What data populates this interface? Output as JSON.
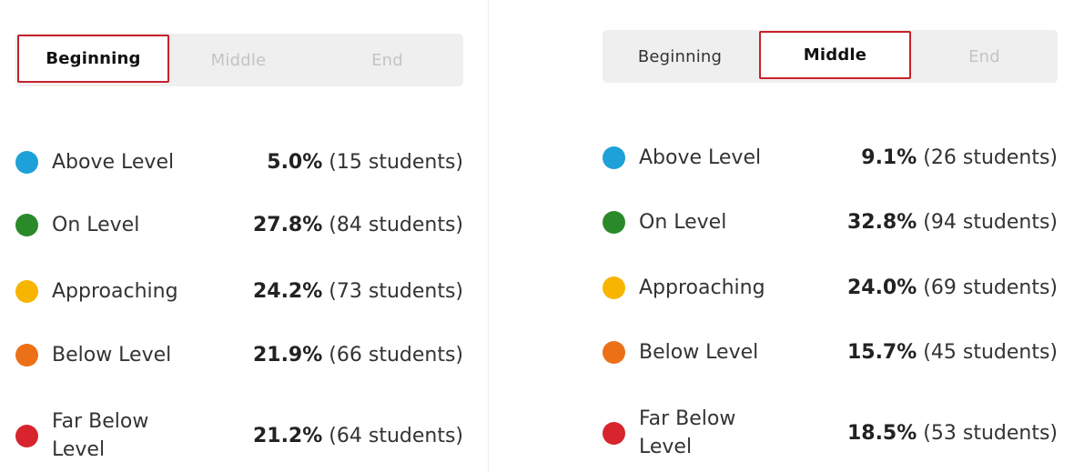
{
  "colors": {
    "above": "#1ea0d8",
    "on": "#2a8a2a",
    "approaching": "#f7b500",
    "below": "#ec7016",
    "far_below": "#d7242d",
    "active_border": "#c8202a"
  },
  "tabs": [
    "Beginning",
    "Middle",
    "End"
  ],
  "panels": [
    {
      "active_tab": "Beginning",
      "rows": [
        {
          "label": "Above Level",
          "pct": "5.0%",
          "count": "(15 students)"
        },
        {
          "label": "On Level",
          "pct": "27.8%",
          "count": "(84 students)"
        },
        {
          "label": "Approaching",
          "pct": "24.2%",
          "count": "(73 students)"
        },
        {
          "label": "Below Level",
          "pct": "21.9%",
          "count": "(66 students)"
        },
        {
          "label": "Far Below Level",
          "pct": "21.2%",
          "count": "(64 students)"
        }
      ]
    },
    {
      "active_tab": "Middle",
      "rows": [
        {
          "label": "Above Level",
          "pct": "9.1%",
          "count": "(26 students)"
        },
        {
          "label": "On Level",
          "pct": "32.8%",
          "count": "(94 students)"
        },
        {
          "label": "Approaching",
          "pct": "24.0%",
          "count": "(69 students)"
        },
        {
          "label": "Below Level",
          "pct": "15.7%",
          "count": "(45 students)"
        },
        {
          "label": "Far Below Level",
          "pct": "18.5%",
          "count": "(53 students)"
        }
      ]
    }
  ]
}
